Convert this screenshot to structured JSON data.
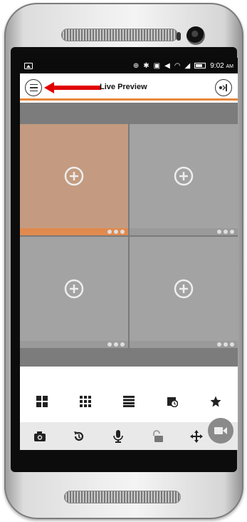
{
  "status_bar": {
    "time": "9:02",
    "ampm": "AM"
  },
  "app_bar": {
    "title": "Live Preview",
    "menu_icon": "menu-icon",
    "exit_icon": "exit-icon"
  },
  "tiles": [
    {
      "selected": true
    },
    {
      "selected": false
    },
    {
      "selected": false
    },
    {
      "selected": false
    }
  ],
  "layout_options": [
    "single-view-icon",
    "nine-view-icon",
    "list-view-icon",
    "playback-icon",
    "favorite-star-icon"
  ],
  "toolbar": [
    "snapshot-camera-icon",
    "history-rotate-icon",
    "microphone-icon",
    "unlock-icon",
    "ptz-move-icon"
  ],
  "colors": {
    "accent": "#e8873a",
    "selected_tile": "#c49b80",
    "tile": "#a3a3a3"
  }
}
